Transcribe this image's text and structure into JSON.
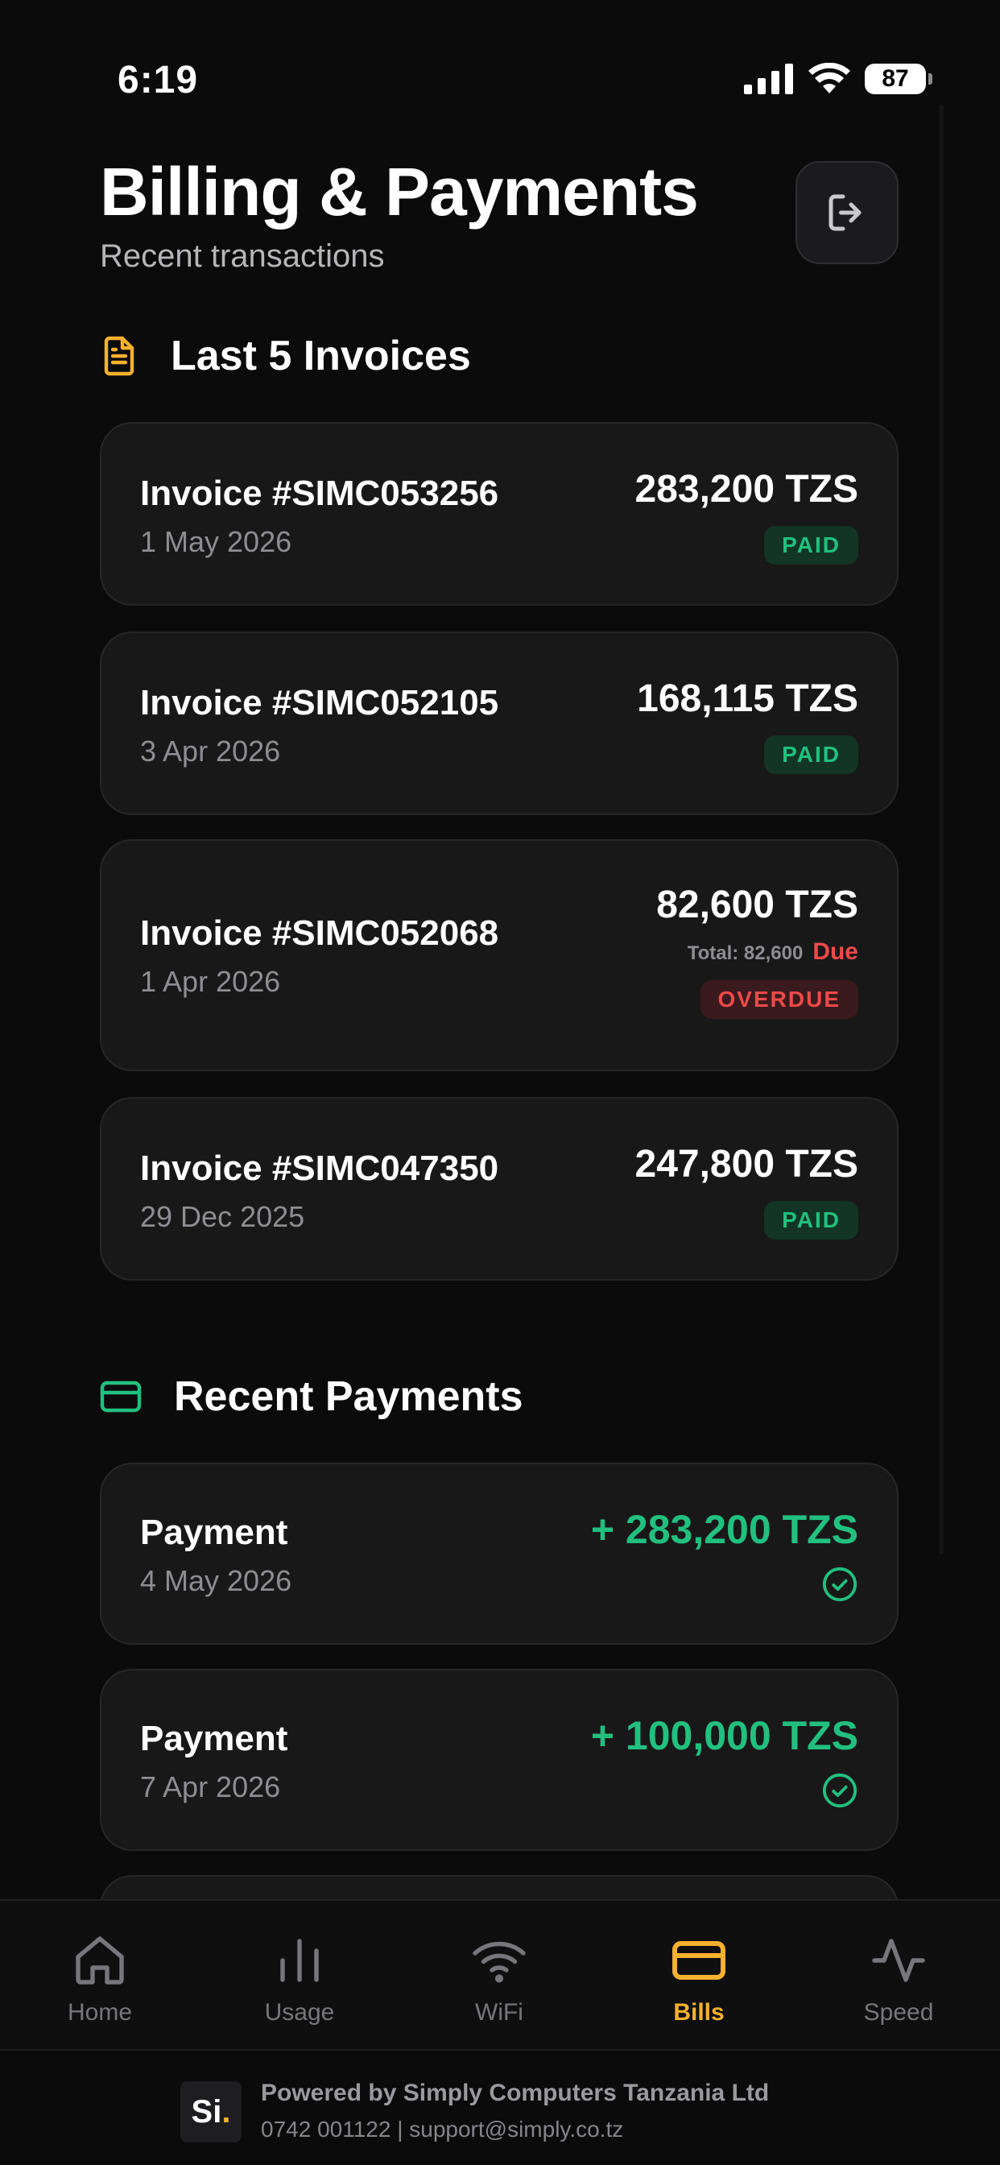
{
  "status_bar": {
    "time": "6:19",
    "battery": "87"
  },
  "header": {
    "title": "Billing & Payments",
    "subtitle": "Recent transactions"
  },
  "invoices_section": {
    "title": "Last 5 Invoices",
    "icon": "document-icon",
    "accent": "#f5b12f",
    "items": [
      {
        "title": "Invoice #SIMC053256",
        "date": "1 May 2026",
        "amount": "283,200 TZS",
        "status": "PAID"
      },
      {
        "title": "Invoice #SIMC052105",
        "date": "3 Apr 2026",
        "amount": "168,115 TZS",
        "status": "PAID"
      },
      {
        "title": "Invoice #SIMC052068",
        "date": "1 Apr 2026",
        "amount": "82,600 TZS",
        "total_label": "Total: 82,600",
        "due_label": "Due",
        "status": "OVERDUE"
      },
      {
        "title": "Invoice #SIMC047350",
        "date": "29 Dec 2025",
        "amount": "247,800 TZS",
        "status": "PAID"
      }
    ]
  },
  "payments_section": {
    "title": "Recent Payments",
    "icon": "card-icon",
    "accent": "#22c07f",
    "items": [
      {
        "title": "Payment",
        "date": "4 May 2026",
        "amount": "+ 283,200 TZS"
      },
      {
        "title": "Payment",
        "date": "7 Apr 2026",
        "amount": "+ 100,000 TZS"
      }
    ]
  },
  "nav": {
    "items": [
      {
        "label": "Home",
        "icon": "home-icon"
      },
      {
        "label": "Usage",
        "icon": "bar-chart-icon"
      },
      {
        "label": "WiFi",
        "icon": "wifi-icon"
      },
      {
        "label": "Bills",
        "icon": "card-icon",
        "active": true
      },
      {
        "label": "Speed",
        "icon": "pulse-icon"
      }
    ]
  },
  "footer": {
    "logo_text": "Si",
    "logo_dot": ".",
    "title": "Powered by Simply Computers Tanzania Ltd",
    "contact": "0742 001122 | support@simply.co.tz"
  },
  "colors": {
    "background": "#0b0b0c",
    "card": "#181819",
    "paid": "#22c07f",
    "overdue": "#ef4a4a",
    "active_nav": "#f5b12f"
  }
}
